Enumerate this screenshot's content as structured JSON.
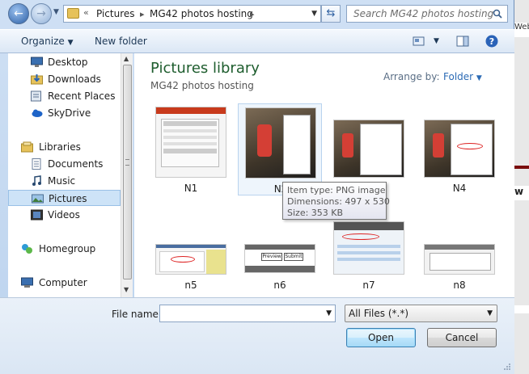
{
  "address": {
    "chevron": "«",
    "segments": [
      "Pictures",
      "MG42 photos hosting"
    ]
  },
  "search": {
    "placeholder": "Search MG42 photos hosting"
  },
  "toolbar": {
    "organize": "Organize",
    "new_folder": "New folder"
  },
  "sidebar": {
    "items": [
      {
        "label": "Desktop",
        "icon": "desktop-icon"
      },
      {
        "label": "Downloads",
        "icon": "downloads-icon"
      },
      {
        "label": "Recent Places",
        "icon": "recent-places-icon"
      },
      {
        "label": "SkyDrive",
        "icon": "skydrive-icon"
      },
      {
        "label": "Libraries",
        "icon": "libraries-icon"
      },
      {
        "label": "Documents",
        "icon": "documents-icon"
      },
      {
        "label": "Music",
        "icon": "music-icon"
      },
      {
        "label": "Pictures",
        "icon": "pictures-icon",
        "selected": true
      },
      {
        "label": "Videos",
        "icon": "videos-icon"
      },
      {
        "label": "Homegroup",
        "icon": "homegroup-icon"
      },
      {
        "label": "Computer",
        "icon": "computer-icon"
      }
    ]
  },
  "content": {
    "title": "Pictures library",
    "subtitle": "MG42 photos hosting",
    "arrange_label": "Arrange by:",
    "arrange_value": "Folder",
    "files": [
      {
        "name": "N1"
      },
      {
        "name": "N2"
      },
      {
        "name": "N3"
      },
      {
        "name": "N4"
      },
      {
        "name": "n5"
      },
      {
        "name": "n6"
      },
      {
        "name": "n7"
      },
      {
        "name": "n8"
      }
    ],
    "n6_buttons": [
      "Preview",
      "Submit"
    ]
  },
  "tooltip": {
    "type": "Item type: PNG image",
    "dimensions": "Dimensions: 497 x 530",
    "size": "Size: 353 KB"
  },
  "footer": {
    "file_name_label": "File name:",
    "file_name_value": "",
    "filter": "All Files (*.*)",
    "open": "Open",
    "cancel": "Cancel"
  },
  "background_app": {
    "text1": "Web",
    "text2": "w"
  },
  "colors": {
    "library_title": "#1e5d2e",
    "link_blue": "#2c6bb5",
    "selection": "#cde3f7"
  }
}
